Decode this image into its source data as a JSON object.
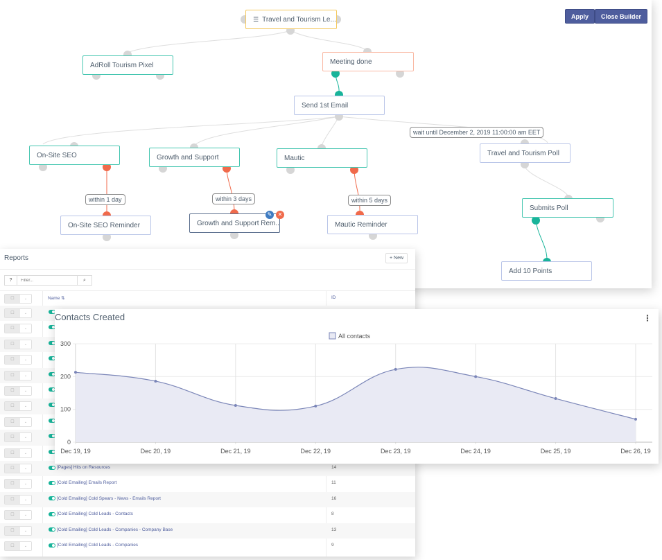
{
  "builder": {
    "apply_label": "Apply",
    "close_label": "Close Builder",
    "nodes": {
      "source": "Travel and Tourism Le...",
      "adroll": "AdRoll Tourism Pixel",
      "meeting": "Meeting done",
      "send_email": "Send 1st Email",
      "onsite_seo": "On-Site SEO",
      "growth": "Growth and Support",
      "mautic": "Mautic",
      "poll": "Travel and Tourism Poll",
      "onsite_reminder": "On-Site SEO Reminder",
      "growth_reminder": "Growth and Support Rem...",
      "mautic_reminder": "Mautic Reminder",
      "submits_poll": "Submits Poll",
      "add_points": "Add 10 Points"
    },
    "edge_labels": {
      "wait": "wait until December 2, 2019 11:00:00 am EET",
      "within_1": "within 1 day",
      "within_3": "within 3 days",
      "within_5": "within 5 days"
    },
    "colors": {
      "primary": "#4e5d9d",
      "yes": "#18b49a",
      "no": "#f06a4b"
    }
  },
  "reports": {
    "title": "Reports",
    "new_label": "+ New",
    "filter_placeholder": "Filter...",
    "columns": {
      "name": "Name",
      "id": "ID"
    },
    "rows": [
      {
        "name": "",
        "id": ""
      },
      {
        "name": "",
        "id": ""
      },
      {
        "name": "",
        "id": ""
      },
      {
        "name": "",
        "id": ""
      },
      {
        "name": "",
        "id": ""
      },
      {
        "name": "",
        "id": ""
      },
      {
        "name": "",
        "id": ""
      },
      {
        "name": "",
        "id": ""
      },
      {
        "name": "",
        "id": ""
      },
      {
        "name": "",
        "id": ""
      },
      {
        "name": "[Pages] Hits on Resources",
        "id": "14"
      },
      {
        "name": "[Cold Emailing] Emails Report",
        "id": "11"
      },
      {
        "name": "[Cold Emailing] Cold Spears - News - Emails Report",
        "id": "16"
      },
      {
        "name": "[Cold Emailing] Cold Leads - Contacts",
        "id": "8"
      },
      {
        "name": "[Cold Emailing] Cold Leads - Companies - Company Base",
        "id": "13"
      },
      {
        "name": "[Cold Emailing] Cold Leads - Companies",
        "id": "9"
      }
    ]
  },
  "chart_data": {
    "type": "area",
    "title": "Contacts Created",
    "categories": [
      "Dec 19, 19",
      "Dec 20, 19",
      "Dec 21, 19",
      "Dec 22, 19",
      "Dec 23, 19",
      "Dec 24, 19",
      "Dec 25, 19",
      "Dec 26, 19"
    ],
    "series": [
      {
        "name": "All contacts",
        "values": [
          213,
          186,
          112,
          110,
          222,
          200,
          133,
          70
        ],
        "color": "#7b86b8",
        "fill": "#e9eaf4"
      }
    ],
    "yticks": [
      0,
      100,
      200,
      300
    ],
    "ylim": [
      0,
      300
    ],
    "xlabel": "",
    "ylabel": "",
    "grid": true,
    "legend": "top-center"
  }
}
